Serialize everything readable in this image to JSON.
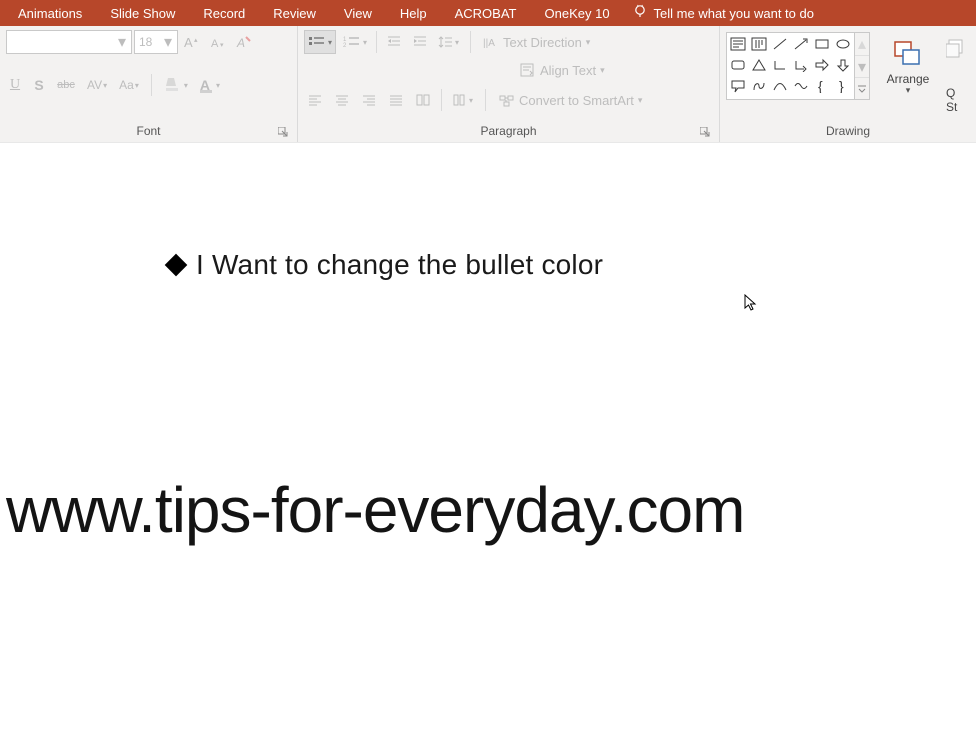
{
  "tabs": {
    "animations": "Animations",
    "slideshow": "Slide Show",
    "record": "Record",
    "review": "Review",
    "view": "View",
    "help": "Help",
    "acrobat": "ACROBAT",
    "onekey": "OneKey 10"
  },
  "tellme": {
    "placeholder": "Tell me what you want to do"
  },
  "font": {
    "size_value": "18",
    "label": "Font",
    "underline": "U",
    "shadow": "S",
    "strike": "abc",
    "charspace": "AV",
    "casechange": "Aa",
    "fontcolor": "A"
  },
  "paragraph": {
    "label": "Paragraph",
    "textdirection": "Text Direction",
    "aligntext": "Align Text",
    "smartart": "Convert to SmartArt"
  },
  "drawing": {
    "label": "Drawing",
    "arrange": "Arrange",
    "quickstyles_q": "Q",
    "quickstyles_st": "St"
  },
  "slide": {
    "bullet_text": "I Want to change the bullet color",
    "watermark": "www.tips-for-everyday.com"
  }
}
